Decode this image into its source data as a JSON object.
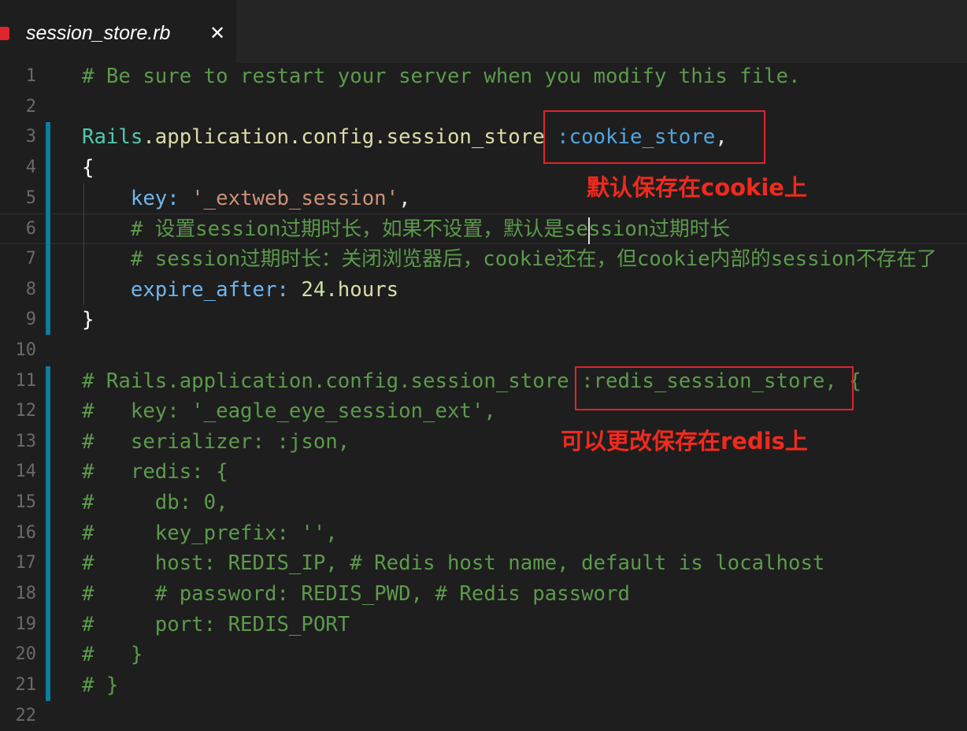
{
  "tab": {
    "title": "session_store.rb",
    "close": "✕"
  },
  "lines": [
    {
      "n": "1",
      "tokens": [
        {
          "t": "# Be sure to restart your server when you modify this file.",
          "k": "cm"
        }
      ]
    },
    {
      "n": "2",
      "tokens": []
    },
    {
      "n": "3",
      "tokens": [
        {
          "t": "Rails",
          "k": "cls"
        },
        {
          "t": ".application.config.session_store",
          "k": "fn"
        },
        {
          "t": " :cookie_store",
          "k": "sym"
        },
        {
          "t": ",",
          "k": "pl"
        }
      ]
    },
    {
      "n": "4",
      "tokens": [
        {
          "t": "{",
          "k": "brace"
        }
      ]
    },
    {
      "n": "5",
      "tokens": [
        {
          "t": "    key:",
          "k": "key"
        },
        {
          "t": " '_extweb_session'",
          "k": "str"
        },
        {
          "t": ",",
          "k": "pl"
        }
      ]
    },
    {
      "n": "6",
      "tokens": [
        {
          "t": "    # 设置session过期时长，如果不设置，默认是session过期时长",
          "k": "cm"
        }
      ]
    },
    {
      "n": "7",
      "tokens": [
        {
          "t": "    # session过期时长：关闭浏览器后，cookie还在，但cookie内部的session不存在了",
          "k": "cm"
        }
      ]
    },
    {
      "n": "8",
      "tokens": [
        {
          "t": "    expire_after:",
          "k": "key"
        },
        {
          "t": " 24",
          "k": "num"
        },
        {
          "t": ".hours",
          "k": "fn"
        }
      ]
    },
    {
      "n": "9",
      "tokens": [
        {
          "t": "}",
          "k": "brace"
        }
      ]
    },
    {
      "n": "10",
      "tokens": []
    },
    {
      "n": "11",
      "tokens": [
        {
          "t": "# Rails.application.config.session_store :redis_session_store, {",
          "k": "cm"
        }
      ]
    },
    {
      "n": "12",
      "tokens": [
        {
          "t": "#   key: '_eagle_eye_session_ext',",
          "k": "cm"
        }
      ]
    },
    {
      "n": "13",
      "tokens": [
        {
          "t": "#   serializer: :json,",
          "k": "cm"
        }
      ]
    },
    {
      "n": "14",
      "tokens": [
        {
          "t": "#   redis: {",
          "k": "cm"
        }
      ]
    },
    {
      "n": "15",
      "tokens": [
        {
          "t": "#     db: 0,",
          "k": "cm"
        }
      ]
    },
    {
      "n": "16",
      "tokens": [
        {
          "t": "#     key_prefix: '',",
          "k": "cm"
        }
      ]
    },
    {
      "n": "17",
      "tokens": [
        {
          "t": "#     host: REDIS_IP, # Redis host name, default is localhost",
          "k": "cm"
        }
      ]
    },
    {
      "n": "18",
      "tokens": [
        {
          "t": "#     # password: REDIS_PWD, # Redis password",
          "k": "cm"
        }
      ]
    },
    {
      "n": "19",
      "tokens": [
        {
          "t": "#     port: REDIS_PORT",
          "k": "cm"
        }
      ]
    },
    {
      "n": "20",
      "tokens": [
        {
          "t": "#   }",
          "k": "cm"
        }
      ]
    },
    {
      "n": "21",
      "tokens": [
        {
          "t": "# }",
          "k": "cm"
        }
      ]
    },
    {
      "n": "22",
      "tokens": []
    }
  ],
  "annotations": {
    "cookie_note": "默认保存在cookie上",
    "redis_note": "可以更改保存在redis上"
  }
}
